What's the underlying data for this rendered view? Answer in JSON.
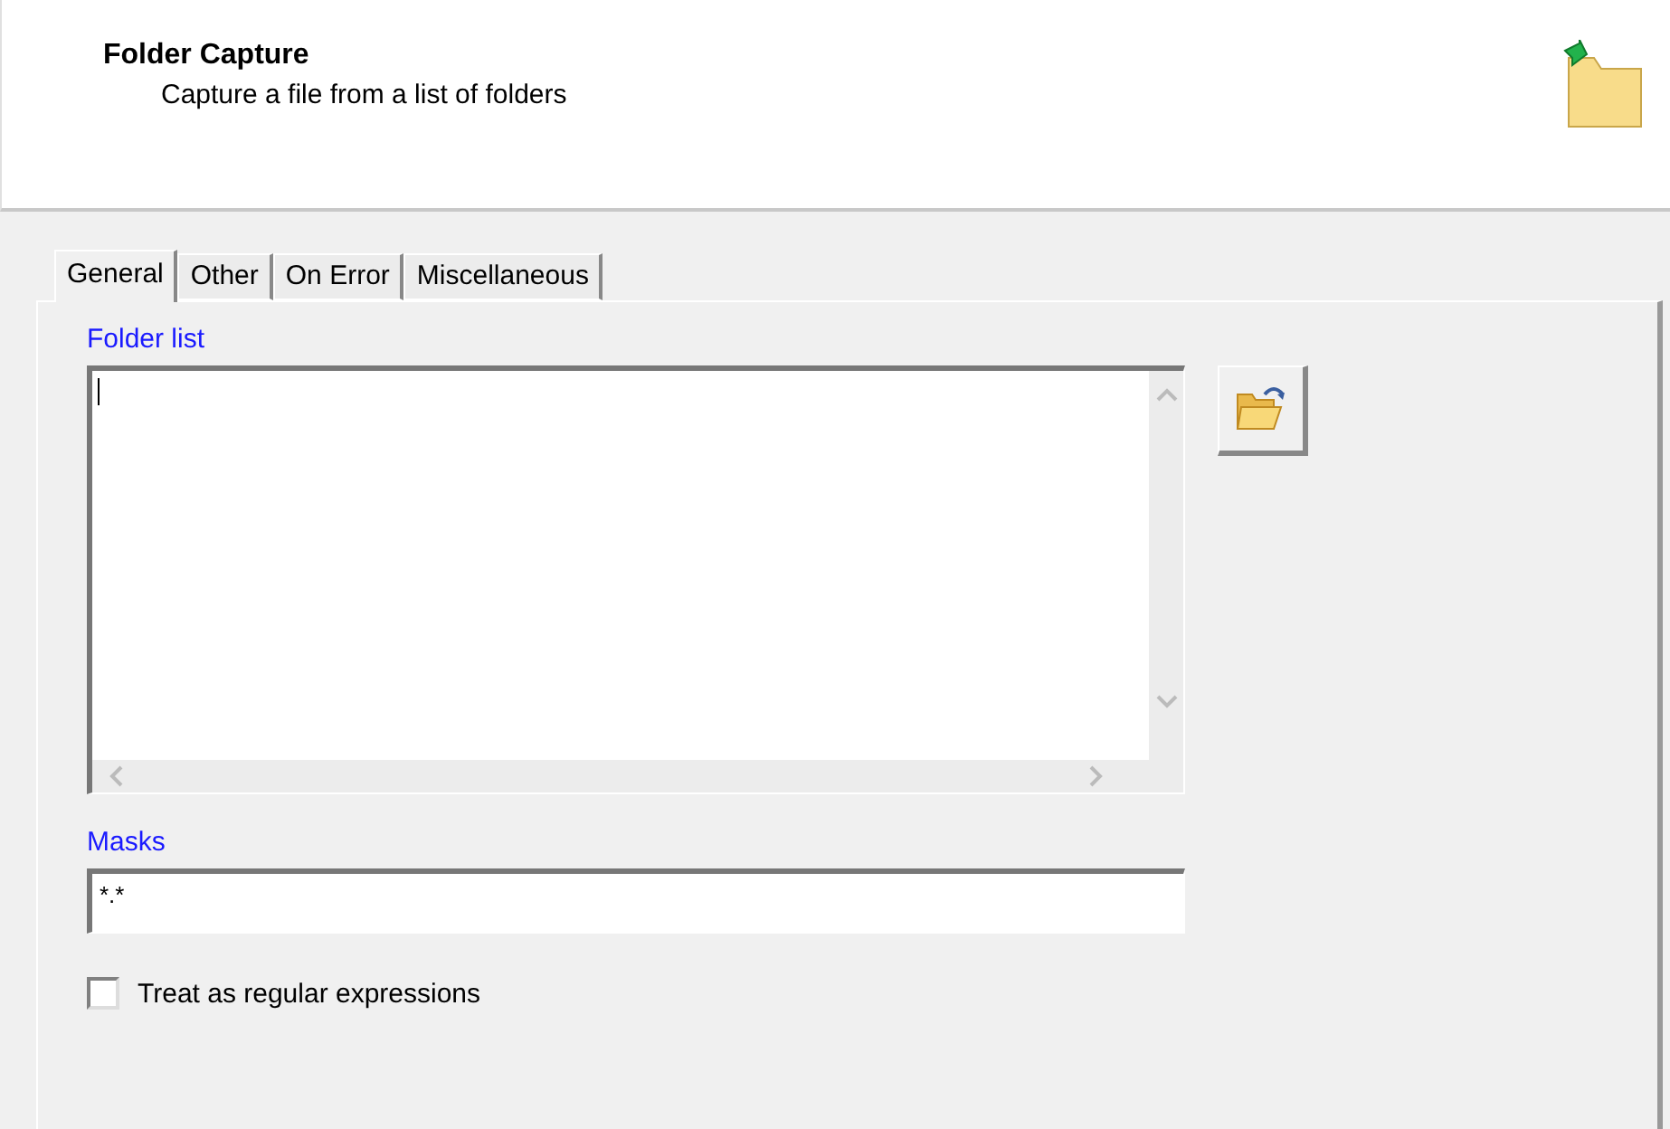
{
  "header": {
    "title": "Folder Capture",
    "subtitle": "Capture a file from a list of folders"
  },
  "tabs": [
    {
      "label": "General",
      "selected": true
    },
    {
      "label": "Other",
      "selected": false
    },
    {
      "label": "On Error",
      "selected": false
    },
    {
      "label": "Miscellaneous",
      "selected": false
    }
  ],
  "folder_list": {
    "label": "Folder list"
  },
  "masks": {
    "label": "Masks",
    "value": "*.*"
  },
  "regex_option": {
    "label": "Treat as regular expressions",
    "checked": false
  }
}
